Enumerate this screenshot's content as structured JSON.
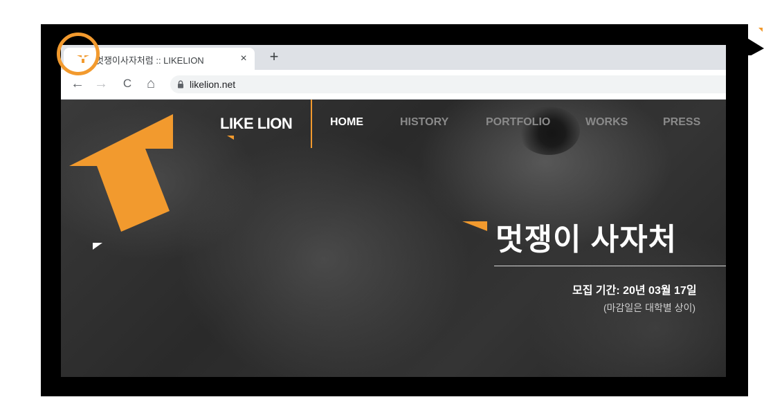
{
  "browser": {
    "tab": {
      "title": "멋쟁이사자처럼 :: LIKELION",
      "favicon": "likelion-favicon-icon",
      "close_label": "×"
    },
    "new_tab_label": "+",
    "toolbar": {
      "back_icon": "←",
      "forward_icon": "→",
      "reload_icon": "C",
      "home_icon": "⌂",
      "url": "likelion.net"
    }
  },
  "site": {
    "logo": "LIKE LION",
    "nav": [
      {
        "label": "HOME",
        "active": true
      },
      {
        "label": "HISTORY",
        "active": false
      },
      {
        "label": "PORTFOLIO",
        "active": false
      },
      {
        "label": "WORKS",
        "active": false
      },
      {
        "label": "PRESS",
        "active": false
      }
    ],
    "hero": {
      "title": "멋쟁이 사자처",
      "period": "모집 기간: 20년 03월 17일",
      "note": "(마감일은 대학별 상이)"
    }
  },
  "annotations": {
    "highlight": "favicon-highlight-circle",
    "arrow": "pointer-arrow",
    "color": "#f29a2e"
  },
  "colors": {
    "accent": "#f29a2e",
    "tabstrip": "#dee1e6",
    "frame": "#000000"
  }
}
